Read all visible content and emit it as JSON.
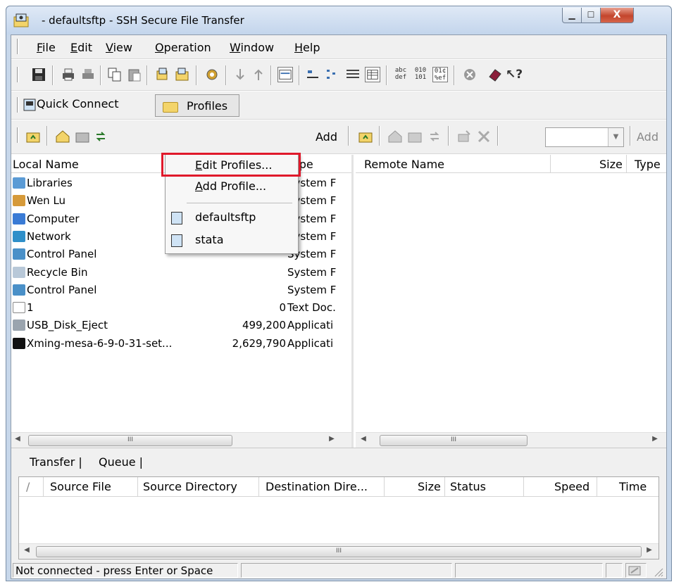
{
  "window": {
    "title": "- defaultsftp - SSH Secure File Transfer",
    "minimize": "▁",
    "maximize": "☐",
    "close": "X"
  },
  "menu": [
    {
      "label": "File",
      "ul": "F",
      "rest": "ile"
    },
    {
      "label": "Edit",
      "ul": "E",
      "rest": "dit"
    },
    {
      "label": "View",
      "ul": "V",
      "rest": "iew"
    },
    {
      "label": "Operation",
      "ul": "O",
      "rest": "peration"
    },
    {
      "label": "Window",
      "ul": "W",
      "rest": "indow"
    },
    {
      "label": "Help",
      "ul": "H",
      "rest": "elp"
    }
  ],
  "toolbar": {
    "icons": [
      "save-icon",
      "print-icon",
      "print-gray-icon",
      "copy-icon",
      "paste-icon",
      "connect-icon",
      "connect-profile-icon",
      "settings-icon",
      "download-icon",
      "upload-icon",
      "new-terminal-icon",
      "large-icons-icon",
      "small-icons-icon",
      "list-view-icon",
      "details-view-icon",
      "ascii-mode-icon",
      "binary-mode-icon",
      "auto-mode-icon",
      "stop-icon",
      "help-book-icon",
      "context-help-icon"
    ],
    "labels": {
      "ascii": "abc\ndef",
      "binary": "010\n101",
      "auto": "01¢\n%ef",
      "help": "?"
    }
  },
  "connection": {
    "quick_connect": "Quick Connect",
    "profiles": "Profiles"
  },
  "local_toolbar": {
    "add": "Add"
  },
  "remote_toolbar": {
    "add": "Add",
    "combo_value": ""
  },
  "local_pane": {
    "columns": [
      "Local Name",
      "Type"
    ],
    "rows": [
      {
        "name": "Libraries",
        "size": "",
        "type": "System F",
        "icon": "#5b9bd5"
      },
      {
        "name": "Wen Lu",
        "size": "",
        "type": "System F",
        "icon": "#d69a3a"
      },
      {
        "name": "Computer",
        "size": "",
        "type": "System F",
        "icon": "#3a7bd5"
      },
      {
        "name": "Network",
        "size": "",
        "type": "System F",
        "icon": "#2f8fc9"
      },
      {
        "name": "Control Panel",
        "size": "",
        "type": "System F",
        "icon": "#4a90c8"
      },
      {
        "name": "Recycle Bin",
        "size": "",
        "type": "System F",
        "icon": "#b8c8d8"
      },
      {
        "name": "Control Panel",
        "size": "",
        "type": "System F",
        "icon": "#4a90c8"
      },
      {
        "name": "1",
        "size": "0",
        "type": "Text Doc.",
        "icon": "#ffffff"
      },
      {
        "name": "USB_Disk_Eject",
        "size": "499,200",
        "type": "Applicati",
        "icon": "#9aa4ae"
      },
      {
        "name": "Xming-mesa-6-9-0-31-set...",
        "size": "2,629,790",
        "type": "Applicati",
        "icon": "#111111"
      }
    ]
  },
  "remote_pane": {
    "columns": [
      "Remote Name",
      "Size",
      "Type"
    ]
  },
  "scroll": {
    "thumb": "III"
  },
  "bottom": {
    "tabs": [
      "Transfer",
      "Queue"
    ],
    "columns": [
      "/",
      "Source File",
      "Source Directory",
      "Destination Dire...",
      "Size",
      "Status",
      "Speed",
      "Time"
    ]
  },
  "status": {
    "text": "Not connected - press Enter or Space"
  },
  "profiles_menu": {
    "edit": {
      "ul": "E",
      "rest": "dit Profiles..."
    },
    "add": {
      "ul": "A",
      "rest": "dd Profile..."
    },
    "items": [
      "defaultsftp",
      "stata"
    ]
  }
}
